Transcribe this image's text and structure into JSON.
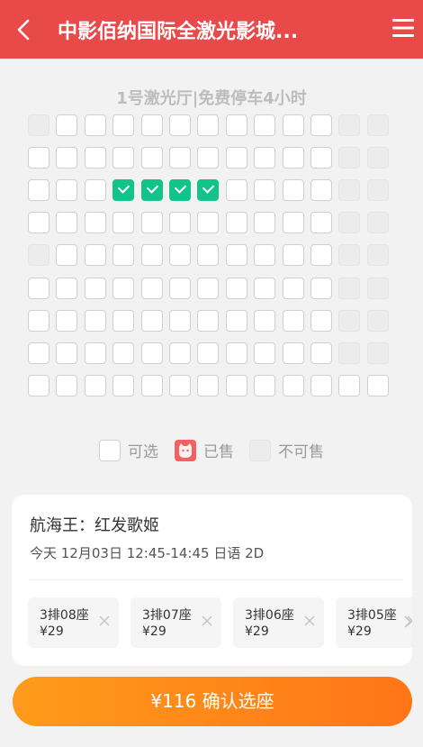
{
  "header": {
    "title": "中影佰纳国际全激光影城...",
    "back_icon": "chevron-left-icon",
    "menu_icon": "hamburger-menu-icon",
    "bg_color": "#e84a4a"
  },
  "hall": {
    "name": "1号激光厅|免费停车4小时"
  },
  "seat_map": {
    "rows": [
      [
        "unavailable",
        "available",
        "available",
        "available",
        "available",
        "available",
        "available",
        "available",
        "available",
        "available",
        "available",
        "unavailable",
        "unavailable"
      ],
      [
        "available",
        "available",
        "available",
        "available",
        "available",
        "available",
        "available",
        "available",
        "available",
        "available",
        "available",
        "unavailable",
        "unavailable"
      ],
      [
        "available",
        "available",
        "available",
        "selected",
        "selected",
        "selected",
        "selected",
        "available",
        "available",
        "available",
        "available",
        "unavailable",
        "unavailable"
      ],
      [
        "available",
        "available",
        "available",
        "available",
        "available",
        "available",
        "available",
        "available",
        "available",
        "available",
        "available",
        "unavailable",
        "unavailable"
      ],
      [
        "unavailable",
        "available",
        "available",
        "available",
        "available",
        "available",
        "available",
        "available",
        "available",
        "available",
        "available",
        "unavailable",
        "unavailable"
      ],
      [
        "available",
        "available",
        "available",
        "available",
        "available",
        "available",
        "available",
        "available",
        "available",
        "available",
        "available",
        "unavailable",
        "unavailable"
      ],
      [
        "available",
        "available",
        "available",
        "available",
        "available",
        "available",
        "available",
        "available",
        "available",
        "available",
        "available",
        "unavailable",
        "unavailable"
      ],
      [
        "available",
        "available",
        "available",
        "available",
        "available",
        "available",
        "available",
        "available",
        "available",
        "available",
        "available",
        "unavailable",
        "unavailable"
      ],
      [
        "available",
        "available",
        "available",
        "available",
        "available",
        "available",
        "available",
        "available",
        "available",
        "available",
        "available",
        "available",
        "available"
      ]
    ],
    "selected_color": "#12c38a"
  },
  "legend": {
    "available": "可选",
    "sold": "已售",
    "unavailable": "不可售",
    "sold_icon": "cat-face-icon",
    "sold_color": "#f06363"
  },
  "movie": {
    "title": "航海王：红发歌姬",
    "showtime": "今天 12月03日 12:45-14:45 日语 2D"
  },
  "selected_seats": [
    {
      "name": "3排08座",
      "price": "¥29"
    },
    {
      "name": "3排07座",
      "price": "¥29"
    },
    {
      "name": "3排06座",
      "price": "¥29"
    },
    {
      "name": "3排05座",
      "price": "¥29"
    }
  ],
  "confirm": {
    "label": "¥116 确认选座",
    "gradient": [
      "#ff9b1a",
      "#ff7518"
    ]
  }
}
